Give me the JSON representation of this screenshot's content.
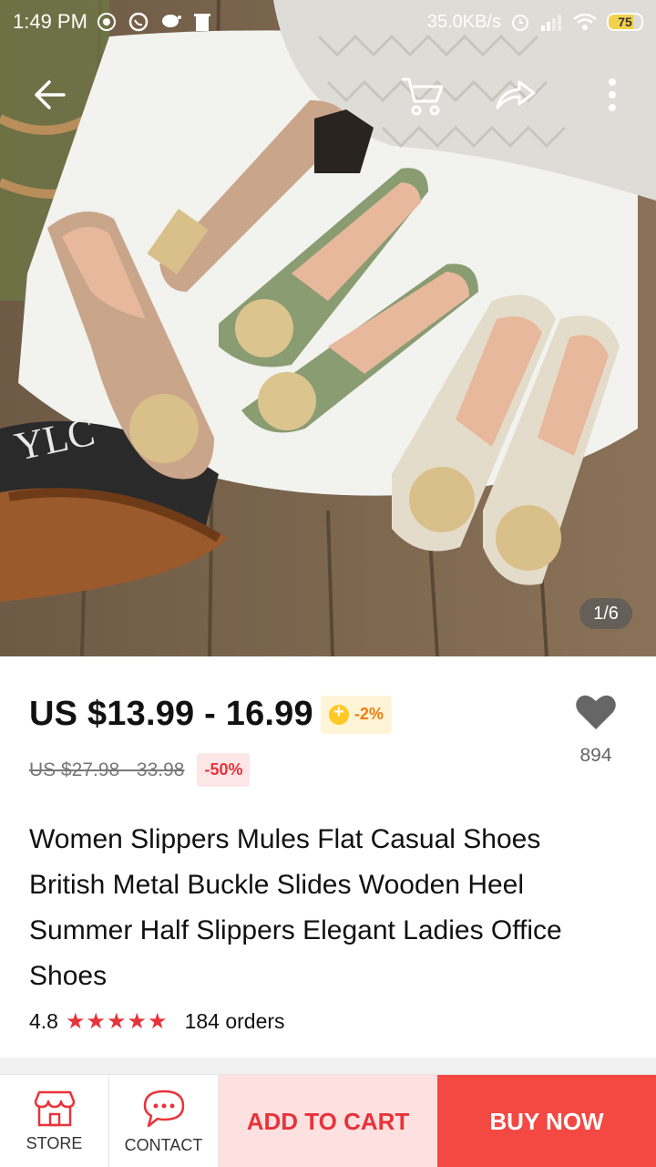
{
  "status_bar": {
    "time": "1:49 PM",
    "net_speed": "35.0KB/s",
    "battery": "75",
    "battery_level": 0.75
  },
  "top_bar": {
    "back_icon": "arrow-left-icon",
    "cart_icon": "cart-icon",
    "share_icon": "share-icon",
    "more_icon": "more-vertical-icon"
  },
  "gallery": {
    "page_indicator": "1/6"
  },
  "product": {
    "price": "US $13.99 - 16.99",
    "coin_badge": "-2%",
    "original_price": "US $27.98 - 33.98",
    "discount": "-50%",
    "wishlist_count": "894",
    "title": "Women Slippers Mules Flat Casual Shoes British Metal Buckle Slides Wooden Heel Summer Half Slippers Elegant Ladies Office Shoes",
    "rating": "4.8",
    "stars": "★★★★★",
    "orders": "184 orders"
  },
  "bottom_bar": {
    "store_label": "STORE",
    "contact_label": "CONTACT",
    "add_to_cart": "ADD TO CART",
    "buy_now": "BUY NOW"
  },
  "colors": {
    "accent_red": "#f44842",
    "price_red": "#e8333a",
    "coin_orange": "#f07a12"
  }
}
